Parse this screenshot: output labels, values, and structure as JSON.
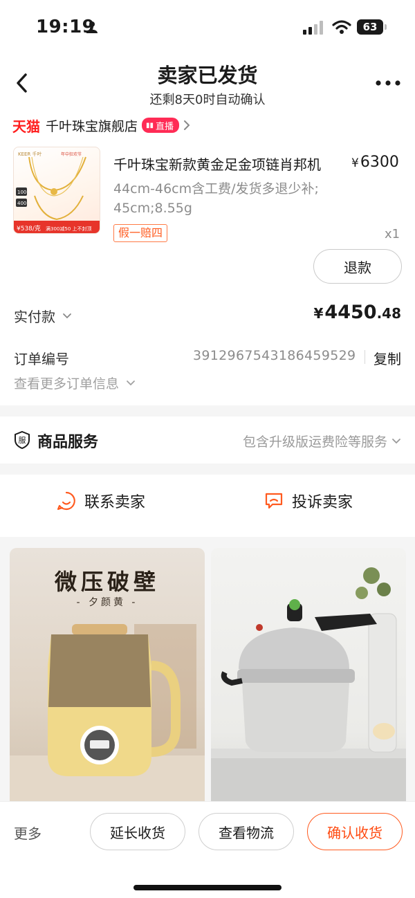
{
  "status_bar": {
    "time": "19:19",
    "battery": "63"
  },
  "header": {
    "title": "卖家已发货",
    "subtitle": "还剩8天0时自动确认"
  },
  "shop": {
    "platform": "天猫",
    "name": "千叶珠宝旗舰店",
    "live_badge": "直播"
  },
  "product": {
    "title": "千叶珠宝新款黄金足金项链肖邦机",
    "price_symbol": "¥",
    "price": "6300",
    "spec": "44cm-46cm含工费/发货多退少补; 45cm;8.55g",
    "tag": "假一赔四",
    "quantity": "x1",
    "image": {
      "brand": "KEER 千叶",
      "event": "年中狂欢节",
      "coupon_1": "100",
      "coupon_2": "400",
      "price_badge": "¥538/克",
      "promo": "满300减50  上不封顶"
    }
  },
  "refund_button": "退款",
  "payment": {
    "label": "实付款",
    "symbol": "¥",
    "integer": "4450",
    "decimal": ".48"
  },
  "order": {
    "label": "订单编号",
    "number": "3912967543186459529",
    "copy": "复制",
    "more_info": "查看更多订单信息"
  },
  "service": {
    "icon_char": "服",
    "title": "商品服务",
    "desc": "包含升级版运费险等服务"
  },
  "contact": {
    "seller": "联系卖家",
    "complain": "投诉卖家"
  },
  "recommendations": [
    {
      "headline": "微压破壁",
      "sub": "- 夕颜黄 -",
      "icon": "soymilk-maker-image"
    },
    {
      "headline": "",
      "sub": "",
      "icon": "pressure-cooker-image"
    }
  ],
  "bottom_bar": {
    "more": "更多",
    "extend": "延长收货",
    "logistics": "查看物流",
    "confirm": "确认收货"
  },
  "colors": {
    "accent": "#ff4a10",
    "tmall_red": "#ff1e1e",
    "live_pink": "#ff2b55",
    "muted": "#8c8c8c",
    "gap": "#f5f5f5"
  }
}
